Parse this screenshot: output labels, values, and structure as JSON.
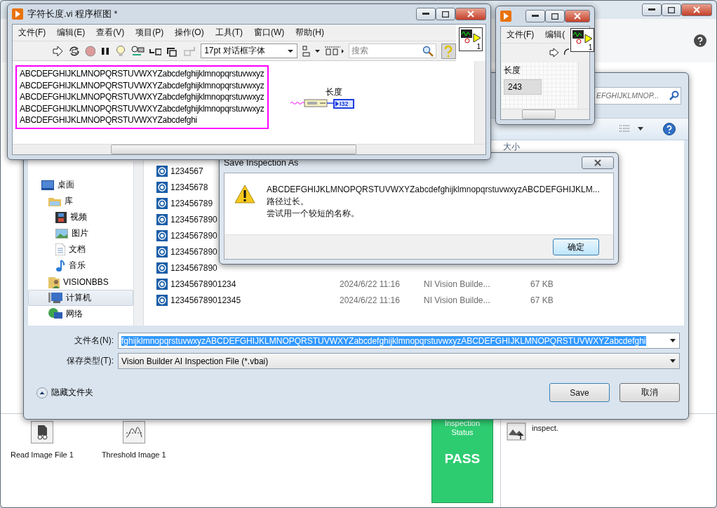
{
  "main_window": {
    "steps": [
      {
        "label": "Read Image File 1",
        "kind": "read"
      },
      {
        "label": "Threshold Image 1",
        "kind": "threshold"
      }
    ],
    "inspection_status": {
      "label": "Inspection Status",
      "result": "PASS"
    },
    "step_help": "inspect."
  },
  "save_dialog": {
    "search_value": "EFGHIJKLMNOP...",
    "column_header": "大小",
    "nav": [
      {
        "label": "桌面",
        "kind": "desktop",
        "selected": false,
        "children": [
          {
            "label": "库",
            "kind": "library",
            "selected": false,
            "children": [
              {
                "label": "视频",
                "kind": "video",
                "selected": false
              },
              {
                "label": "图片",
                "kind": "pictures",
                "selected": false
              },
              {
                "label": "文档",
                "kind": "documents",
                "selected": false
              },
              {
                "label": "音乐",
                "kind": "music",
                "selected": false
              }
            ]
          },
          {
            "label": "VISIONBBS",
            "kind": "user",
            "selected": false
          },
          {
            "label": "计算机",
            "kind": "computer",
            "selected": true
          },
          {
            "label": "网络",
            "kind": "network",
            "selected": false
          }
        ]
      }
    ],
    "files": [
      {
        "name": "1234567"
      },
      {
        "name": "12345678"
      },
      {
        "name": "123456789"
      },
      {
        "name": "1234567890"
      },
      {
        "name": "1234567890"
      },
      {
        "name": "1234567890"
      },
      {
        "name": "1234567890"
      },
      {
        "name": "12345678901234",
        "date": "2024/6/22 11:16",
        "type": "NI Vision Builde...",
        "size": "67 KB"
      },
      {
        "name": "123456789012345",
        "date": "2024/6/22 11:16",
        "type": "NI Vision Builde...",
        "size": "67 KB"
      }
    ],
    "filename_label": "文件名(N):",
    "filename_value": "fghijklmnopqrstuvwxyzABCDEFGHIJKLMNOPQRSTUVWXYZabcdefghijklmnopqrstuvwxyzABCDEFGHIJKLMNOPQRSTUVWXYZabcdefghi",
    "filename_selected": true,
    "type_label": "保存类型(T):",
    "type_value": "Vision Builder AI Inspection File (*.vbai)",
    "hide_folders": "隐藏文件夹",
    "buttons": [
      {
        "label": "Save"
      },
      {
        "label": "取消"
      }
    ]
  },
  "message_box": {
    "title": "Save Inspection As",
    "lines": [
      "ABCDEFGHIJKLMNOPQRSTUVWXYZabcdefghijklmnopqrstuvwxyzABCDEFGHIJKLM...",
      "路径过长。",
      "尝试用一个较短的名称。"
    ],
    "button": "确定"
  },
  "block_diagram": {
    "title": "字符长度.vi 程序框图 *",
    "menu": [
      "文件(F)",
      "编辑(E)",
      "查看(V)",
      "项目(P)",
      "操作(O)",
      "工具(T)",
      "窗口(W)",
      "帮助(H)"
    ],
    "font_select": "17pt 对话框字体",
    "search_placeholder": "搜索",
    "context_help_on": true,
    "vi_icon_number": "1",
    "string_constant": [
      "ABCDEFGHIJKLMNOPQRSTUVWXYZabcdefghijklmnopqrstuvwxyz",
      "ABCDEFGHIJKLMNOPQRSTUVWXYZabcdefghijklmnopqrstuvwxyz",
      "ABCDEFGHIJKLMNOPQRSTUVWXYZabcdefghijklmnopqrstuvwxyz",
      "ABCDEFGHIJKLMNOPQRSTUVWXYZabcdefghijklmnopqrstuvwxyz",
      "ABCDEFGHIJKLMNOPQRSTUVWXYZabcdefghi"
    ],
    "indicator_label": "长度",
    "indicator_type": "I32"
  },
  "front_panel": {
    "menu": [
      "文件(F)",
      "编辑("
    ],
    "vi_icon_number": "1",
    "indicator_label": "长度",
    "indicator_value": "243"
  }
}
